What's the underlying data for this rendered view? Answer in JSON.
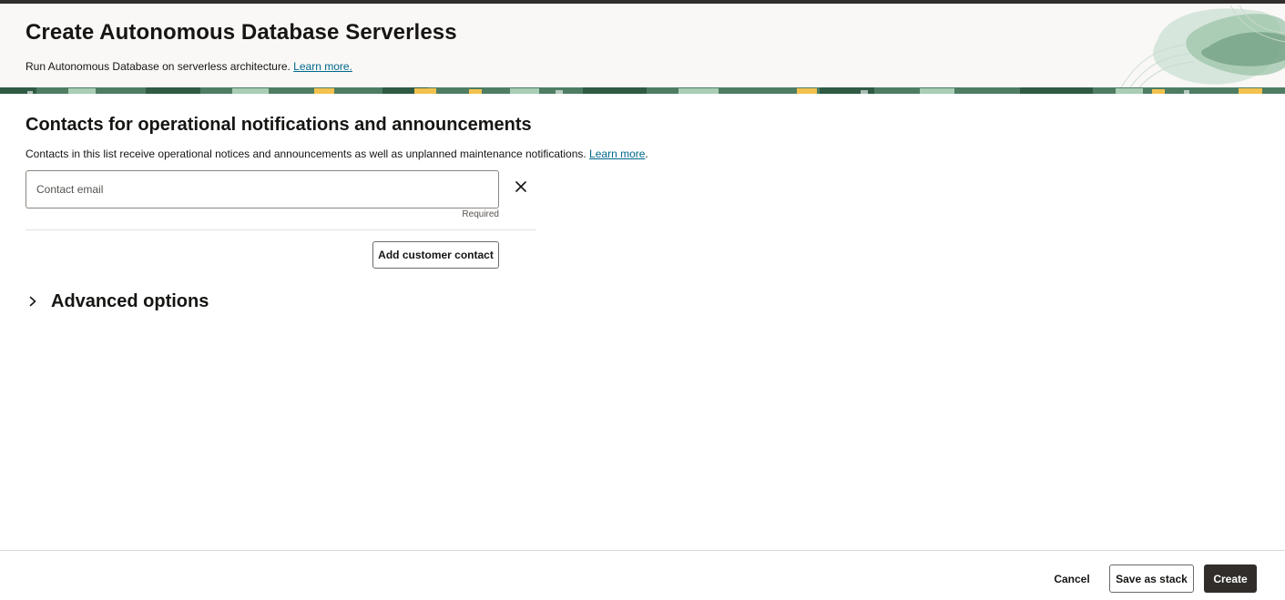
{
  "header": {
    "title": "Create Autonomous Database Serverless",
    "subtitle": "Run Autonomous Database on serverless architecture.",
    "learn_more": "Learn more."
  },
  "contacts": {
    "title": "Contacts for operational notifications and announcements",
    "description": "Contacts in this list receive operational notices and announcements as well as unplanned maintenance notifications.",
    "learn_more": "Learn more",
    "email_placeholder": "Contact email",
    "email_value": "",
    "required_text": "Required",
    "add_button": "Add customer contact"
  },
  "advanced": {
    "label": "Advanced options",
    "expanded": false
  },
  "footer": {
    "cancel": "Cancel",
    "save_as_stack": "Save as stack",
    "create": "Create"
  },
  "colors": {
    "link": "#00688c",
    "primary_button": "#312d2a",
    "banner_green": "#4e7d63",
    "banner_yellow": "#f2c14e"
  },
  "icons": {
    "remove": "close-icon",
    "expand": "chevron-right-icon"
  }
}
